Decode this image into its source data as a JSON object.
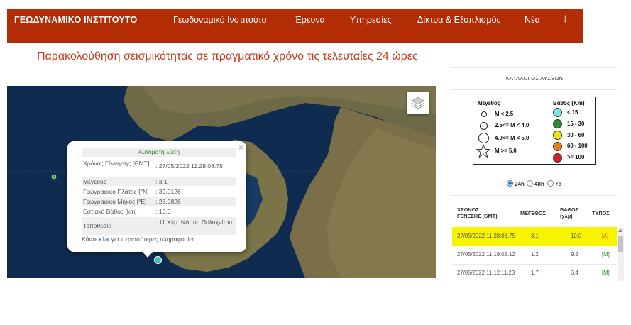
{
  "nav": {
    "brand": "ΓΕΩΔΥΝΑΜΙΚΟ ΙΝΣΤΙΤΟΥΤΟ",
    "links": [
      "Γεωδυναμικό Ινστιτούτο",
      "Έρευνα",
      "Υπηρεσίες",
      "Δίκτυα & Εξοπλισμός",
      "Νέα"
    ],
    "arrow_icon": "arrow-down-icon"
  },
  "headline": "Παρακολούθηση σεισμικότητας σε πραγματικό χρόνο τις τελευταίες 24 ώρες",
  "map": {
    "layers_icon": "layers-icon",
    "popup": {
      "close": "×",
      "title": "Αυτόματη λύση",
      "rows": [
        {
          "label": "Χρόνος Γέννησης [GMT]",
          "value": ": 27/05/2022 11:28:08.75"
        },
        {
          "label": "Μέγεθος",
          "value": ": 3.1"
        },
        {
          "label": "Γεωγραφικό Πλάτος [°N]",
          "value": ": 39.0126"
        },
        {
          "label": "Γεωγραφικό Μήκος [°E]",
          "value": ": 26.0826"
        },
        {
          "label": "Εστιακό Βάθος [km]",
          "value": ": 10.0"
        },
        {
          "label": "Τοποθεσία",
          "value": ": 11 Χλμ. ΝΔ του Πολυχνίτου"
        }
      ],
      "footer_prefix": "Κάντε ",
      "footer_link": "κλικ",
      "footer_suffix": " για περισσότερες πληροφορίες"
    }
  },
  "catalog": {
    "title": "ΚΑΤΑΛΟΓΟΣ ΛΥΣΕΩΝ",
    "legend": {
      "magnitude_title": "Μέγεθος",
      "depth_title": "Βάθος (Km)",
      "magnitude_items": [
        "M < 2.5",
        "2.5<= M < 4.0",
        "4.0<= M < 5.0",
        "M >= 5.0"
      ],
      "depth_items": [
        {
          "label": "< 15",
          "color": "#7fe3df"
        },
        {
          "label": "15 - 30",
          "color": "#2e8b2e"
        },
        {
          "label": "30 - 60",
          "color": "#f2e600"
        },
        {
          "label": "60 - 100",
          "color": "#ef7c1a"
        },
        {
          "label": ">= 100",
          "color": "#d81f1f"
        }
      ]
    },
    "ranges": [
      {
        "label": "24h",
        "selected": true
      },
      {
        "label": "48h",
        "selected": false
      },
      {
        "label": "7d",
        "selected": false
      }
    ],
    "columns": {
      "time_line1": "ΧΡΟΝΟΣ",
      "time_line2": "ΓΕΝΕΣΗΣ (GMT)",
      "magnitude": "ΜΕΓΕΘΟΣ",
      "depth_line1": "ΒΑΘΟΣ",
      "depth_line2": "(χλμ)",
      "type": "ΤΥΠΟΣ"
    },
    "rows": [
      {
        "time": "27/05/2022 11:28:08.75",
        "magnitude": "3.1",
        "depth": "10.0",
        "type": "[A]"
      },
      {
        "time": "27/05/2022 11:19:02.12",
        "magnitude": "1.2",
        "depth": "9.2",
        "type": "[M]"
      },
      {
        "time": "27/05/2022 11:12:11.23",
        "magnitude": "1.7",
        "depth": "6.4",
        "type": "[M]"
      }
    ]
  }
}
